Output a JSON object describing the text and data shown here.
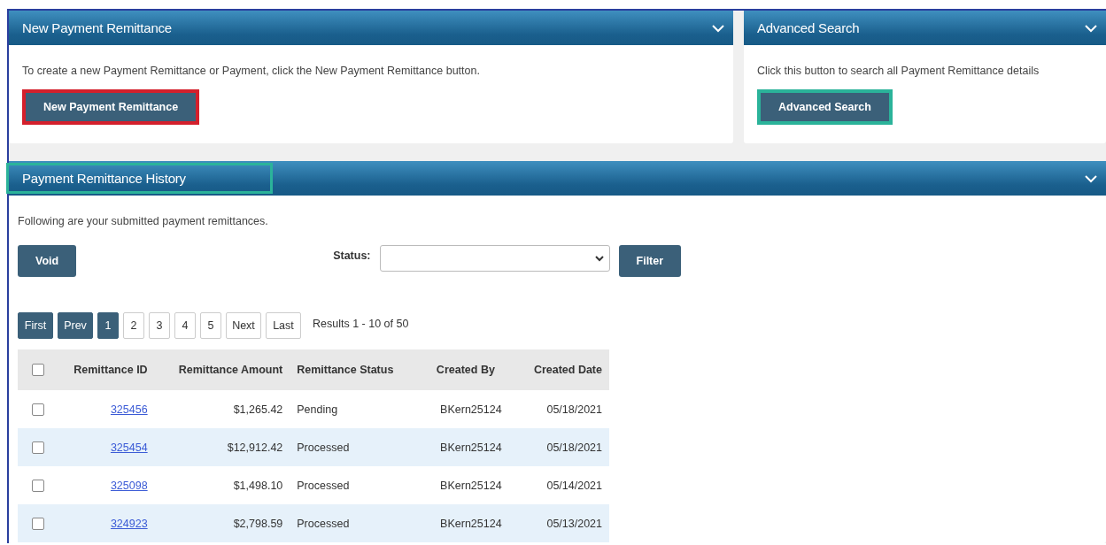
{
  "new_panel": {
    "title": "New Payment Remittance",
    "expanded": true,
    "text": "To create a new Payment Remittance or Payment, click the New Payment Remittance button.",
    "button": {
      "label": "New Payment Remittance",
      "highlight": {
        "color": "#d4202c"
      }
    }
  },
  "search_panel": {
    "title": "Advanced Search",
    "expanded": true,
    "text": "Click this button to search all Payment Remittance details",
    "button": {
      "label": "Advanced Search",
      "highlight": {
        "color": "#2bb39a"
      }
    }
  },
  "history_panel": {
    "title": "Payment Remittance History",
    "title_highlight": {
      "color": "#2bb39a"
    },
    "expanded": true,
    "text": "Following are your submitted payment remittances.",
    "void_button": "Void",
    "status_label": "Status:",
    "filter_button": "Filter",
    "pagination": [
      {
        "label": "First",
        "kind": "nav"
      },
      {
        "label": "Prev",
        "kind": "nav"
      },
      {
        "label": "1",
        "kind": "page",
        "selected": true
      },
      {
        "label": "2",
        "kind": "page",
        "selected": false
      },
      {
        "label": "3",
        "kind": "page",
        "selected": false
      },
      {
        "label": "4",
        "kind": "page",
        "selected": false
      },
      {
        "label": "5",
        "kind": "page",
        "selected": false
      },
      {
        "label": "Next",
        "kind": "link"
      },
      {
        "label": "Last",
        "kind": "link"
      }
    ],
    "results": "Results 1 - 10 of 50",
    "table": {
      "all_checked": false,
      "columns": [
        "Remittance ID",
        "Remittance Amount",
        "Remittance Status",
        "Created By",
        "Created Date"
      ],
      "rows": [
        {
          "checked": false,
          "id": "325456",
          "amount": "$1,265.42",
          "status": "Pending",
          "created_by": "BKern25124",
          "date": "05/18/2021"
        },
        {
          "checked": false,
          "id": "325454",
          "amount": "$12,912.42",
          "status": "Processed",
          "created_by": "BKern25124",
          "date": "05/18/2021"
        },
        {
          "checked": false,
          "id": "325098",
          "amount": "$1,498.10",
          "status": "Processed",
          "created_by": "BKern25124",
          "date": "05/14/2021"
        },
        {
          "checked": false,
          "id": "324923",
          "amount": "$2,798.59",
          "status": "Processed",
          "created_by": "BKern25124",
          "date": "05/13/2021"
        }
      ]
    }
  }
}
